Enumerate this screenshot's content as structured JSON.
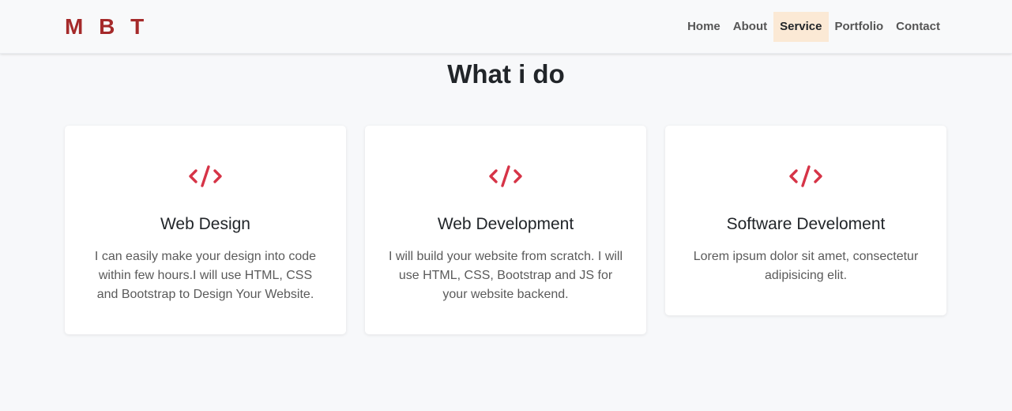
{
  "brand": "M B T",
  "nav": {
    "items": [
      {
        "label": "Home",
        "active": false
      },
      {
        "label": "About",
        "active": false
      },
      {
        "label": "Service",
        "active": true
      },
      {
        "label": "Portfolio",
        "active": false
      },
      {
        "label": "Contact",
        "active": false
      }
    ]
  },
  "section": {
    "title": "What i do"
  },
  "services": [
    {
      "icon": "code-icon",
      "title": "Web Design",
      "text": "I can easily make your design into code within few hours.I will use HTML, CSS and Bootstrap to Design Your Website."
    },
    {
      "icon": "code-icon",
      "title": "Web Development",
      "text": "I will build your website from scratch. I will use HTML, CSS, Bootstrap and JS for your website backend."
    },
    {
      "icon": "code-icon",
      "title": "Software Develoment",
      "text": "Lorem ipsum dolor sit amet, consectetur adipisicing elit."
    }
  ],
  "colors": {
    "brand": "#a52a2a",
    "accent": "#d63447",
    "active_nav_bg": "#fbe9d5",
    "background": "#f7f8fa"
  }
}
